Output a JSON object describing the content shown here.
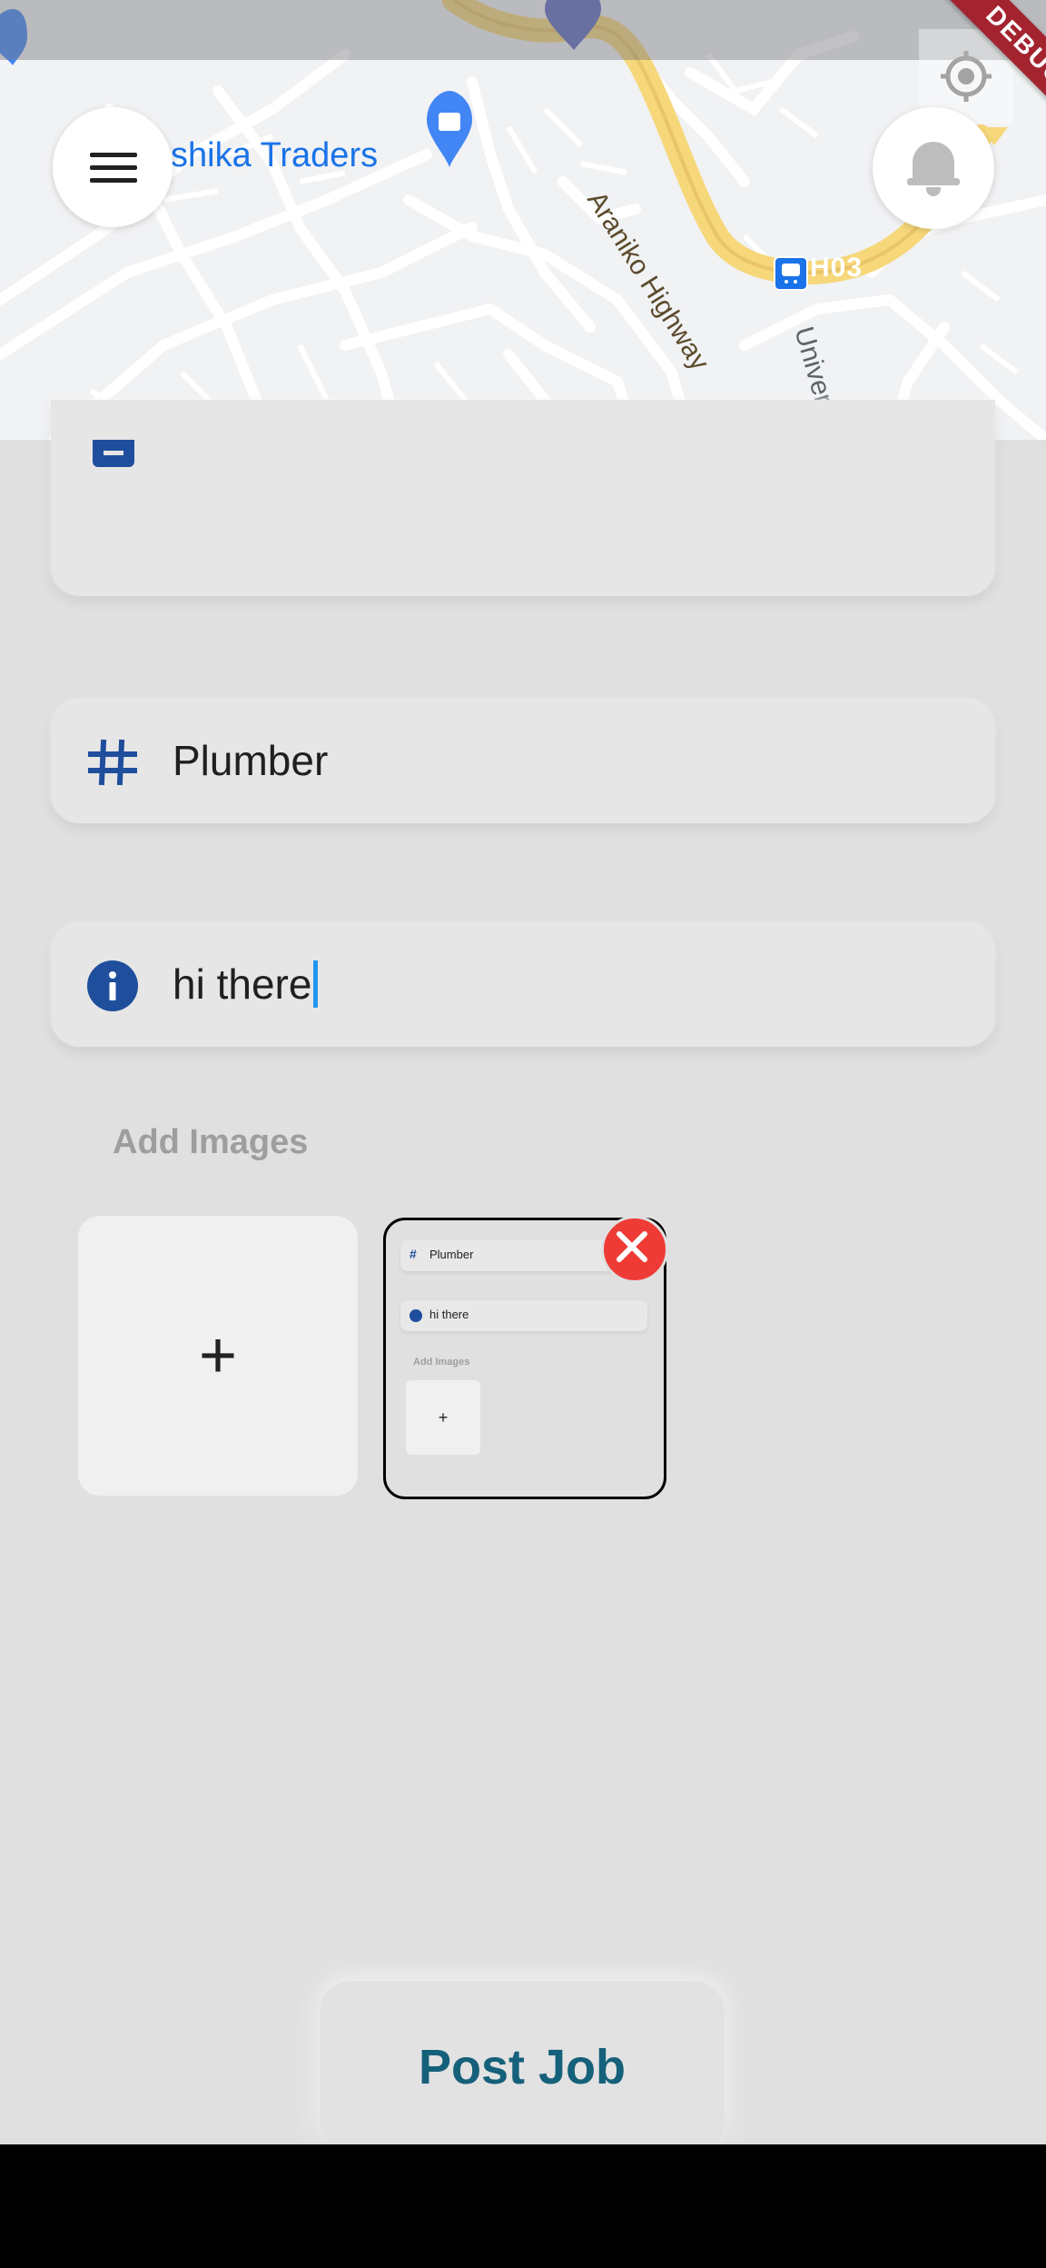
{
  "map": {
    "poi_label": "shika Traders",
    "highway_label": "Araniko Highway",
    "route_badge": "H03",
    "road_label": "University I"
  },
  "debug_banner": "DEBUG",
  "form": {
    "category_value": "Plumber",
    "description_value": "hi there",
    "images_section_title": "Add Images",
    "add_image_symbol": "+",
    "thumbnail": {
      "category_value": "Plumber",
      "description_value": "hi there",
      "images_section_title": "Add Images",
      "add_image_symbol": "+"
    }
  },
  "post_button_label": "Post Job",
  "colors": {
    "accent": "#1f4e9c",
    "button_text": "#15607a",
    "remove": "#ef3b36",
    "caret": "#2196f3"
  },
  "icons": {
    "menu": "hamburger-icon",
    "notifications": "bell-icon",
    "category_field": "hash-icon",
    "description_field": "info-icon",
    "remove_image": "close-icon",
    "add_image": "plus-icon"
  }
}
